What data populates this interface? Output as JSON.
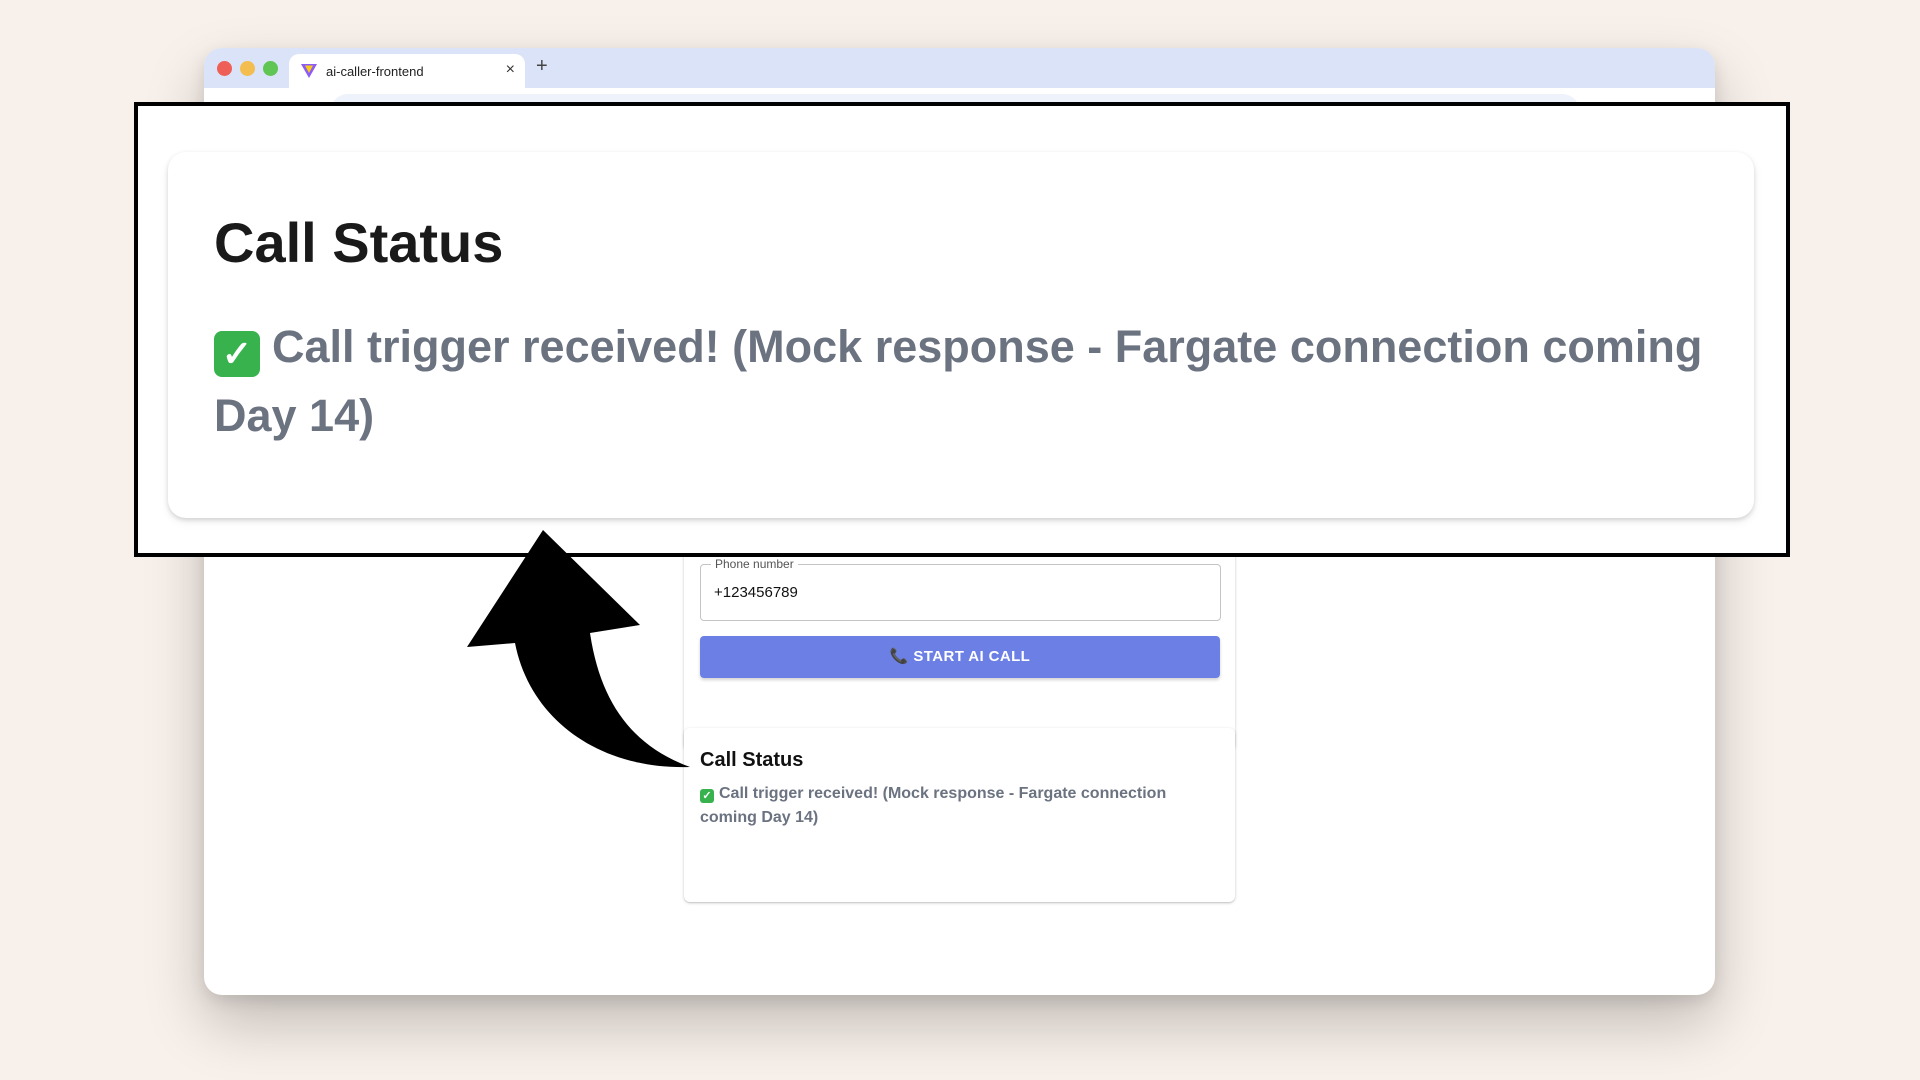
{
  "browser": {
    "tab_title": "ai-caller-frontend",
    "tab_close": "×",
    "new_tab": "+"
  },
  "form": {
    "phone_label": "Phone number",
    "phone_value": "+123456789",
    "start_button_icon": "📞",
    "start_button": "START AI CALL"
  },
  "status": {
    "title": "Call Status",
    "check_icon": "✓",
    "message": "Call trigger received! (Mock response - Fargate connection coming Day 14)"
  },
  "zoom": {
    "title": "Call Status",
    "message": "Call trigger received! (Mock response - Fargate connection coming Day 14)"
  },
  "colors": {
    "background": "#f8f0ea",
    "tabbar": "#dbe3f8",
    "button": "#6b7fe4",
    "status_text": "#6b7280",
    "check": "#37b24d"
  }
}
